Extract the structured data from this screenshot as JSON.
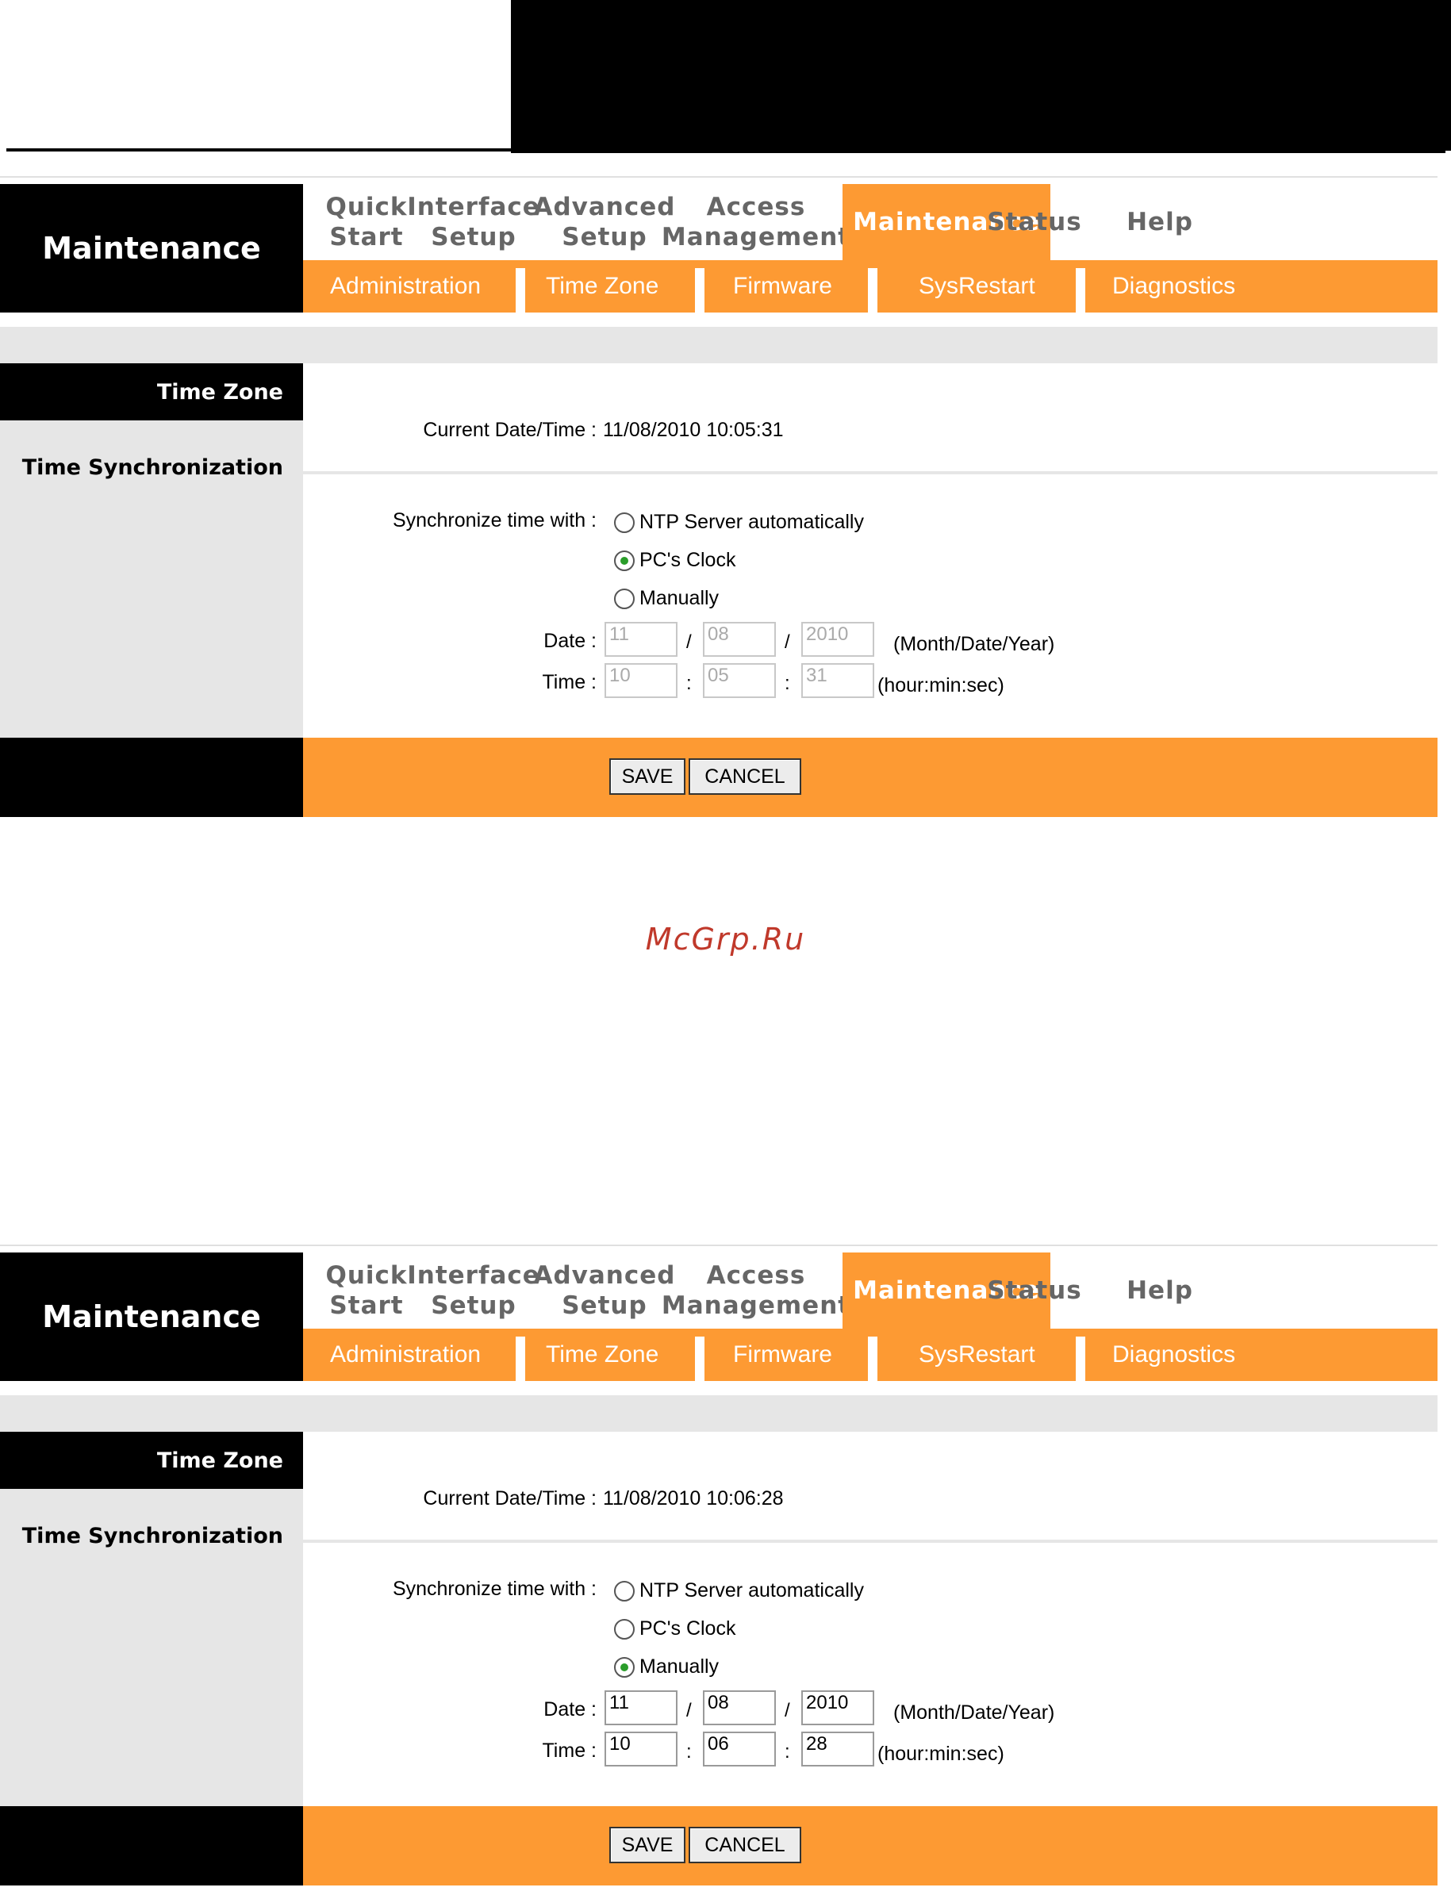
{
  "brand": "Maintenance",
  "nav": [
    "Quick\nStart",
    "Interface\nSetup",
    "Advanced\nSetup",
    "Access\nManagement",
    "Maintenance",
    "Status",
    "Help"
  ],
  "nav_active": "Maintenance",
  "subnav": [
    "Administration",
    "Time Zone",
    "Firmware",
    "SysRestart",
    "Diagnostics"
  ],
  "colors": {
    "accent": "#fd9a33",
    "dark": "#000000",
    "grey": "#e6e6e6",
    "radio_on": "#2a9d2a"
  },
  "left": {
    "section_header": "Time Zone",
    "section_label": "Time Synchronization"
  },
  "form": {
    "current_label": "Current Date/Time :",
    "sync_label": "Synchronize time with :",
    "options": [
      "NTP Server automatically",
      "PC's Clock",
      "Manually"
    ],
    "date_label": "Date :",
    "time_label": "Time :",
    "date_sep": "/",
    "time_sep": ":",
    "date_hint": "(Month/Date/Year)",
    "time_hint": "(hour:min:sec)"
  },
  "buttons": {
    "save": "SAVE",
    "cancel": "CANCEL"
  },
  "screens": [
    {
      "current": "11/08/2010 10:05:31",
      "selected": "PC's Clock",
      "date": [
        "11",
        "08",
        "2010"
      ],
      "time": [
        "10",
        "05",
        "31"
      ],
      "fields_enabled": false
    },
    {
      "current": "11/08/2010 10:06:28",
      "selected": "Manually",
      "date": [
        "11",
        "08",
        "2010"
      ],
      "time": [
        "10",
        "06",
        "28"
      ],
      "fields_enabled": true
    }
  ],
  "watermark": "McGrp.Ru"
}
